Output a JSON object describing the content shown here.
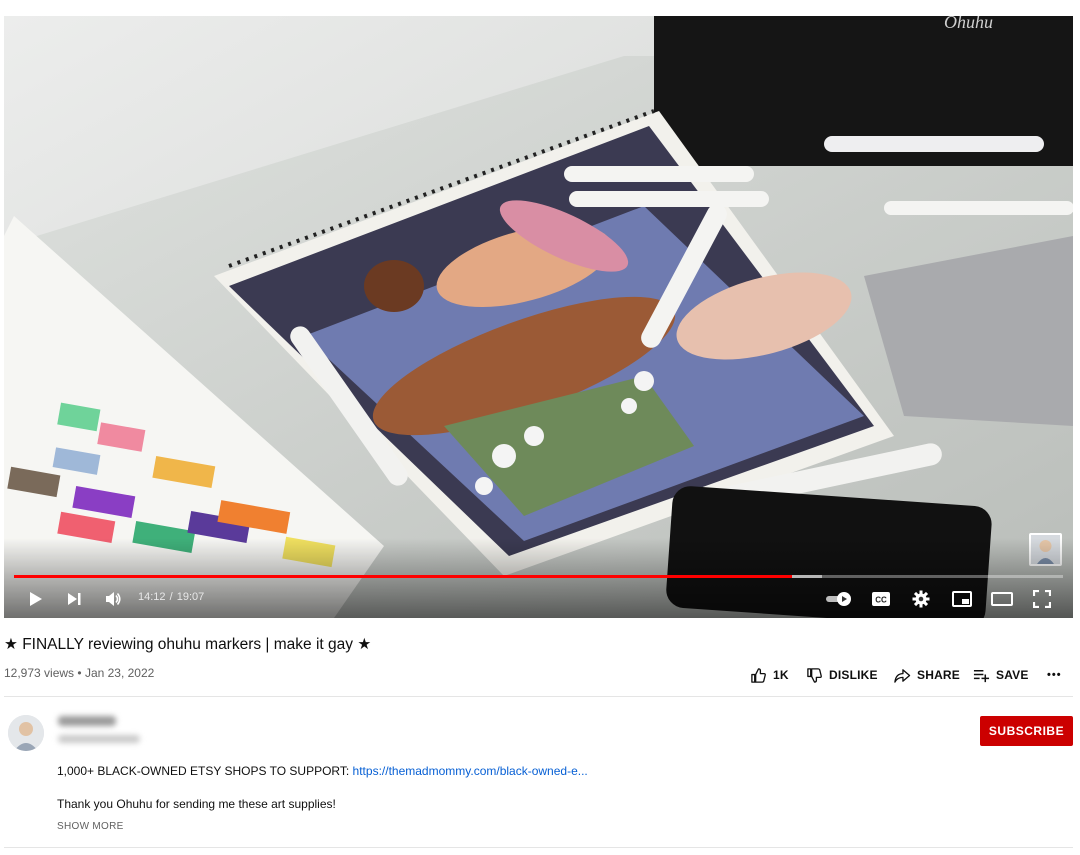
{
  "player": {
    "brand_text": "Ohuhu",
    "current_time": "14:12",
    "time_separator": "/",
    "duration": "19:07",
    "played_fraction": 0.742,
    "buffered_fraction": 0.77,
    "controls": [
      "play",
      "next",
      "volume",
      "autoplay-toggle",
      "captions",
      "settings",
      "miniplayer",
      "theater",
      "fullscreen"
    ]
  },
  "video": {
    "title": "★ FINALLY reviewing ohuhu markers | make it gay ★",
    "views": "12,973 views",
    "dot": "•",
    "date": "Jan 23, 2022"
  },
  "actions": {
    "like_count": "1K",
    "dislike_label": "DISLIKE",
    "share_label": "SHARE",
    "save_label": "SAVE",
    "more_label": "•••"
  },
  "channel": {
    "subscribe_label": "SUBSCRIBE"
  },
  "description": {
    "line1_text": "1,000+ BLACK-OWNED ETSY SHOPS TO SUPPORT: ",
    "line1_link": "https://themadmommy.com/black-owned-e...",
    "line2_text": "Thank you Ohuhu for sending me these art supplies!",
    "show_more_label": "SHOW MORE"
  },
  "colors": {
    "progress_played": "#ff0000",
    "subscribe_bg": "#cc0000",
    "link": "#065fd4"
  }
}
